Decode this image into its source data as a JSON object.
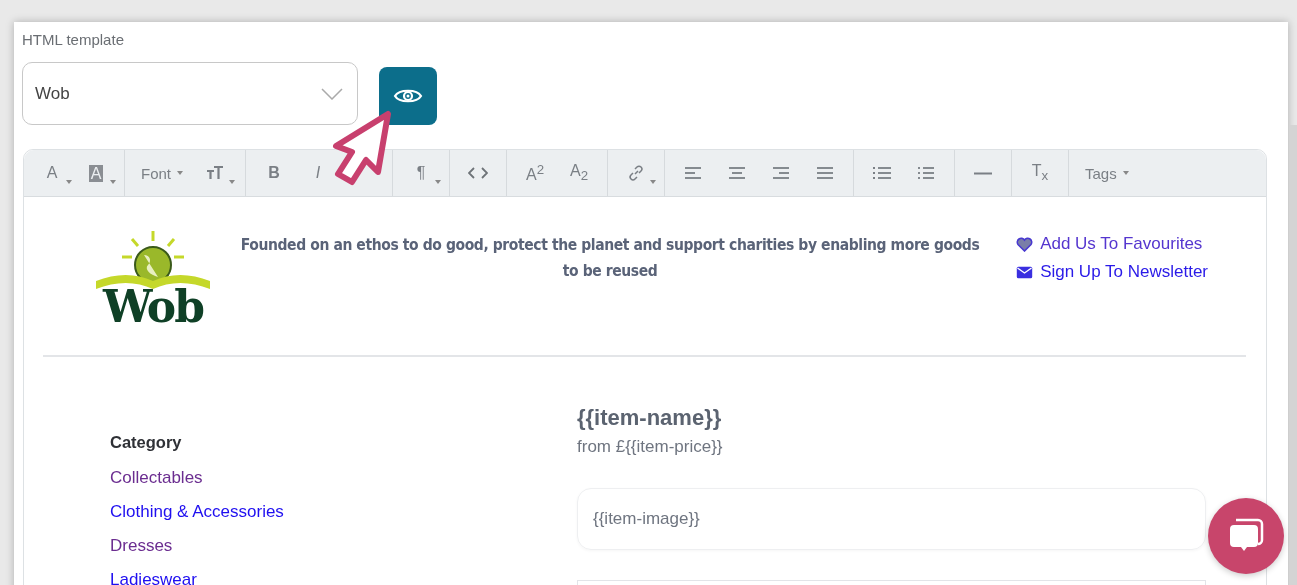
{
  "template_field": {
    "label": "HTML template",
    "value": "Wob"
  },
  "toolbar": {
    "groups": [
      [
        {
          "kind": "text",
          "label": "A",
          "caret": true
        },
        {
          "kind": "highlight",
          "label": "A",
          "caret": true
        }
      ],
      [
        {
          "kind": "dropdown",
          "label": "Font"
        },
        {
          "kind": "font-size",
          "caret": true
        }
      ],
      [
        {
          "kind": "bold",
          "label": "B"
        },
        {
          "kind": "italic",
          "label": "I"
        }
      ],
      [
        {
          "kind": "text",
          "label": "¶",
          "caret": true
        }
      ],
      [
        {
          "kind": "code"
        }
      ],
      [
        {
          "kind": "text",
          "label": "A$^{2}$"
        },
        {
          "kind": "text",
          "label": "A$_{2}$"
        }
      ],
      [
        {
          "kind": "link",
          "caret": true
        }
      ],
      [
        {
          "kind": "align-left"
        },
        {
          "kind": "align-center"
        },
        {
          "kind": "align-right"
        },
        {
          "kind": "align-justify"
        }
      ],
      [
        {
          "kind": "bullet-list"
        },
        {
          "kind": "numbered-list"
        }
      ],
      [
        {
          "kind": "rule"
        }
      ],
      [
        {
          "kind": "text",
          "label": "T$_{x}$"
        }
      ],
      [
        {
          "kind": "dropdown",
          "label": "Tags"
        }
      ]
    ]
  },
  "header": {
    "logo_text": "Wob",
    "tagline": "Founded on an ethos to do good, protect the planet and support charities by enabling more goods to be reused",
    "links": [
      {
        "kind": "heart",
        "label": "Add Us To Favourites",
        "visited": true
      },
      {
        "kind": "mail",
        "label": "Sign Up To Newsletter",
        "visited": false
      }
    ]
  },
  "category": {
    "title": "Category",
    "items": [
      {
        "label": "Collectables",
        "visited": true
      },
      {
        "label": "Clothing & Accessories",
        "visited": false
      },
      {
        "label": "Dresses",
        "visited": true
      },
      {
        "label": "Ladieswear",
        "visited": false
      }
    ]
  },
  "item": {
    "name": "{{item-name}}",
    "price": "from £{{item-price}}",
    "image": "{{item-image}}"
  }
}
